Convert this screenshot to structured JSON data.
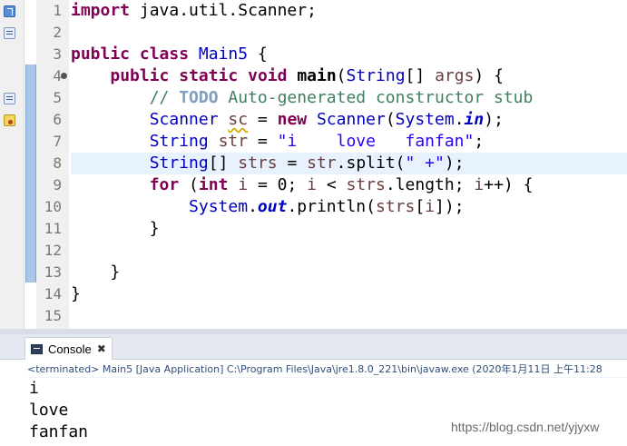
{
  "gutter": {
    "line_numbers": [
      "1",
      "2",
      "3",
      "4",
      "5",
      "6",
      "7",
      "8",
      "9",
      "10",
      "11",
      "12",
      "13",
      "14",
      "15"
    ],
    "markers": [
      {
        "line": 1,
        "icon": "quickfix-icon"
      },
      {
        "line": 2,
        "icon": "task-icon"
      },
      {
        "line": 5,
        "icon": "task-icon"
      },
      {
        "line": 6,
        "icon": "warning-icon"
      }
    ],
    "fold_line": 4,
    "current_line": 8
  },
  "code": {
    "l1_kw": "import",
    "l1_rest": " java.util.Scanner;",
    "l3_kw1": "public",
    "l3_kw2": "class",
    "l3_name": "Main5",
    "l3_rest": " {",
    "l4_indent": "    ",
    "l4_kw1": "public",
    "l4_kw2": "static",
    "l4_kw3": "void",
    "l4_name": "main",
    "l4_paren": "(",
    "l4_type": "String",
    "l4_arr": "[] ",
    "l4_param": "args",
    "l4_rest": ") {",
    "l5_indent": "        ",
    "l5_slashes": "// ",
    "l5_todo": "TODO",
    "l5_rest": " Auto-generated constructor stub",
    "l6_indent": "        ",
    "l6_type": "Scanner",
    "l6_var": "sc",
    "l6_eq": " = ",
    "l6_kw": "new",
    "l6_ctor": "Scanner",
    "l6_paren": "(",
    "l6_sys": "System",
    "l6_dot": ".",
    "l6_field": "in",
    "l6_rest": ");",
    "l7_indent": "        ",
    "l7_type": "String",
    "l7_var": "str",
    "l7_eq": " = ",
    "l7_str": "\"i    love   fanfan\"",
    "l7_rest": ";",
    "l8_indent": "        ",
    "l8_type": "String",
    "l8_arr": "[] ",
    "l8_var": "strs",
    "l8_eq": " = ",
    "l8_var2": "str",
    "l8_call": ".split(",
    "l8_str": "\" +\"",
    "l8_rest": ");",
    "l9_indent": "        ",
    "l9_kw": "for",
    "l9_open": " (",
    "l9_kw2": "int",
    "l9_i1": "i",
    "l9_init": " = 0; ",
    "l9_i2": "i",
    "l9_lt": " < ",
    "l9_strs": "strs",
    "l9_len": ".length; ",
    "l9_i3": "i",
    "l9_rest": "++) {",
    "l10_indent": "            ",
    "l10_sys": "System",
    "l10_dot": ".",
    "l10_field": "out",
    "l10_call": ".println(",
    "l10_strs": "strs",
    "l10_br": "[",
    "l10_i": "i",
    "l10_rest": "]);",
    "l11_text": "        }",
    "l13_text": "    }",
    "l14_text": "}"
  },
  "console": {
    "tab_label": "Console",
    "close_glyph": "✖",
    "status": "<terminated> Main5 [Java Application] C:\\Program Files\\Java\\jre1.8.0_221\\bin\\javaw.exe (2020年1月11日 上午11:28",
    "output": [
      "i",
      "love",
      "fanfan"
    ]
  },
  "watermark": "https://blog.csdn.net/yjyxw",
  "colors": {
    "keyword": "#7f0055",
    "string": "#2a00ff",
    "comment": "#3f7f5f",
    "type": "#0000c0",
    "local_var": "#6a3e3e",
    "current_line_bg": "#e8f2fe",
    "scope_bar": "#a7c6e8"
  }
}
